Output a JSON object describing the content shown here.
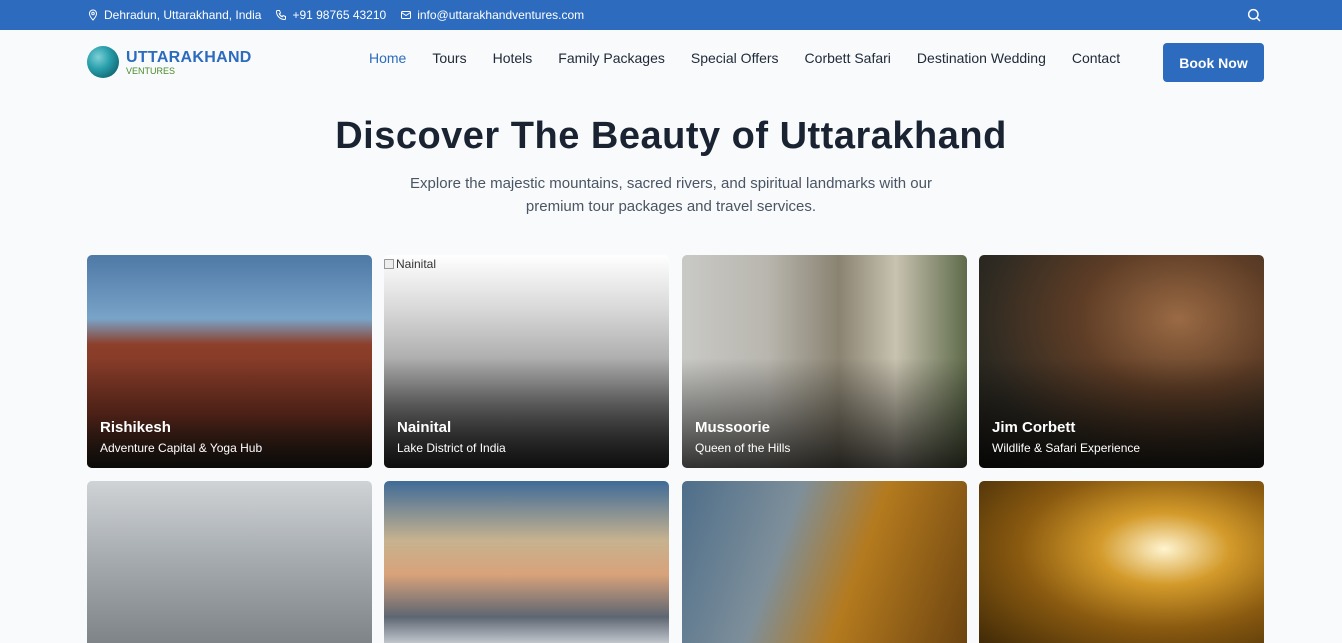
{
  "topbar": {
    "location": "Dehradun, Uttarakhand, India",
    "phone": "+91 98765 43210",
    "email": "info@uttarakhandventures.com"
  },
  "logo": {
    "title": "UTTARAKHAND",
    "subtitle": "VENTURES"
  },
  "nav": {
    "items": [
      "Home",
      "Tours",
      "Hotels",
      "Family Packages",
      "Special Offers",
      "Corbett Safari",
      "Destination Wedding",
      "Contact"
    ],
    "active": "Home",
    "book_label": "Book Now"
  },
  "hero": {
    "title": "Discover The Beauty of Uttarakhand",
    "subtitle": "Explore the majestic mountains, sacred rivers, and spiritual landmarks with our premium tour packages and travel services."
  },
  "destinations": [
    {
      "name": "Rishikesh",
      "desc": "Adventure Capital & Yoga Hub"
    },
    {
      "name": "Nainital",
      "desc": "Lake District of India",
      "alt": "Nainital"
    },
    {
      "name": "Mussoorie",
      "desc": "Queen of the Hills"
    },
    {
      "name": "Jim Corbett",
      "desc": "Wildlife & Safari Experience"
    }
  ],
  "colors": {
    "primary": "#2c6bbd",
    "heading": "#1a2332",
    "accent_green": "#4a8a2a"
  }
}
